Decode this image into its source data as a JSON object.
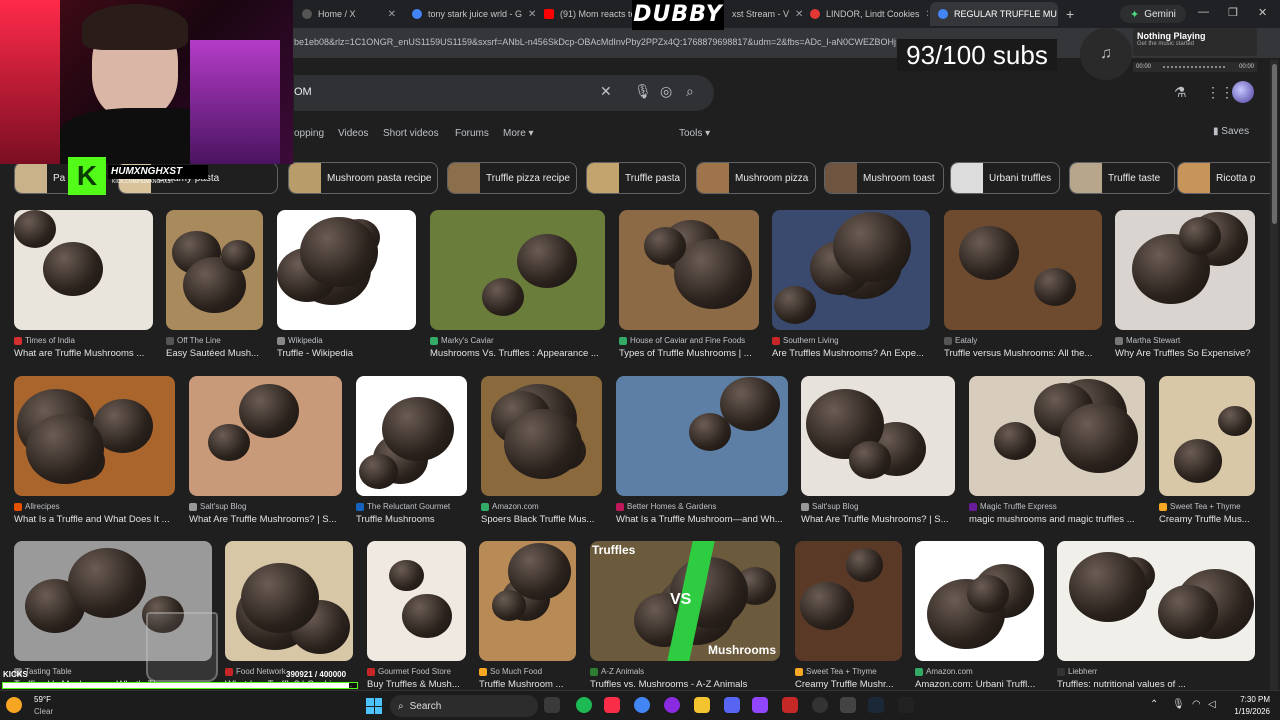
{
  "browser": {
    "tabs": [
      {
        "title": "Home / X",
        "favicon_color": "#1d1d1d",
        "active": false
      },
      {
        "title": "tony stark juice wrld - G",
        "favicon_color": "#4285f4",
        "active": false
      },
      {
        "title": "(91) Mom reacts to U",
        "favicon_color": "#ff0000",
        "active": false
      },
      {
        "title": "xst Stream - V",
        "favicon_color": "#9146ff",
        "active": false
      },
      {
        "title": "LINDOR, Lindt Cookies",
        "favicon_color": "#e53935",
        "active": false
      },
      {
        "title": "REGULAR TRUFFLE MU",
        "favicon_color": "#4285f4",
        "active": true
      }
    ],
    "new_tab_label": "+",
    "gemini_label": "Gemini",
    "url": "be1eb08&rlz=1C1ONGR_enUS1159US1159&sxsrf=ANbL-n456SkDcp-OBAcMdInvPby2PPZx4Q:1768879698817&udm=2&fbs=ADc_l-aN0CWEZBOHj"
  },
  "google": {
    "query_suffix": "OM",
    "nav_tabs": [
      "opping",
      "Videos",
      "Short videos",
      "Forums",
      "More ▾"
    ],
    "tools_label": "Tools ▾",
    "saves_label": "Saves",
    "chips": [
      {
        "label": "Pa",
        "color": "#c9b28a"
      },
      {
        "label": "Creamy pasta",
        "color": "#d8c39a"
      },
      {
        "label": "Mushroom pasta recipe",
        "color": "#b89c6a"
      },
      {
        "label": "Truffle pizza recipe",
        "color": "#8b6f4a"
      },
      {
        "label": "Truffle pasta",
        "color": "#c4a46e"
      },
      {
        "label": "Mushroom pizza",
        "color": "#a0744a"
      },
      {
        "label": "Mushroom toast",
        "color": "#6f5440"
      },
      {
        "label": "Urbani truffles",
        "color": "#dcdcdc"
      },
      {
        "label": "Truffle taste",
        "color": "#b8a68c"
      },
      {
        "label": "Ricotta p",
        "color": "#c7955a"
      }
    ],
    "results": [
      {
        "source": "Times of India",
        "caption": "What are Truffle Mushrooms ...",
        "bg": "#e9e4dc",
        "sico": "#d32f2f"
      },
      {
        "source": "Off The Line",
        "caption": "Easy Sautéed Mush...",
        "bg": "#a88a5c",
        "sico": "#555"
      },
      {
        "source": "Wikipedia",
        "caption": "Truffle - Wikipedia",
        "bg": "#ffffff",
        "sico": "#888"
      },
      {
        "source": "Marky's Caviar",
        "caption": "Mushrooms Vs. Truffles : Appearance ...",
        "bg": "#6a7d3a",
        "sico": "#3a6"
      },
      {
        "source": "House of Caviar and Fine Foods",
        "caption": "Types of Truffle Mushrooms | ...",
        "bg": "#8b6a45",
        "sico": "#3a6"
      },
      {
        "source": "Southern Living",
        "caption": "Are Truffles Mushrooms? An Expe...",
        "bg": "#3a4a6e",
        "sico": "#c62828"
      },
      {
        "source": "Eataly",
        "caption": "Truffle versus Mushrooms: All the...",
        "bg": "#6e4b2e",
        "sico": "#555"
      },
      {
        "source": "Martha Stewart",
        "caption": "Why Are Truffles So Expensive?",
        "bg": "#d9d4cf",
        "sico": "#777"
      },
      {
        "source": "Allrecipes",
        "caption": "What Is a Truffle and What Does It ...",
        "bg": "#a9652c",
        "sico": "#e65100"
      },
      {
        "source": "Salt'sup Blog",
        "caption": "What Are Truffle Mushrooms? | S...",
        "bg": "#c99a7a",
        "sico": "#999"
      },
      {
        "source": "The Reluctant Gourmet",
        "caption": "Truffle Mushrooms",
        "bg": "#ffffff",
        "sico": "#1565c0"
      },
      {
        "source": "Amazon.com",
        "caption": "Spoers Black Truffle Mus...",
        "bg": "#8a6a3c",
        "sico": "#3a6"
      },
      {
        "source": "Better Homes & Gardens",
        "caption": "What Is a Truffle Mushroom—and Wh...",
        "bg": "#5d7fa6",
        "sico": "#c2185b"
      },
      {
        "source": "Salt'sup Blog",
        "caption": "What Are Truffle Mushrooms? | S...",
        "bg": "#e7e2db",
        "sico": "#999"
      },
      {
        "source": "Magic Truffle Express",
        "caption": "magic mushrooms and magic truffles ...",
        "bg": "#d8cdbd",
        "sico": "#6a1b9a"
      },
      {
        "source": "Sweet Tea + Thyme",
        "caption": "Creamy Truffle Mus...",
        "bg": "#d8c8a8",
        "sico": "#f9a825"
      },
      {
        "source": "Tasting Table",
        "caption": "Truffles Vs Mushrooms: What's The ...",
        "bg": "#9a9a9a",
        "sico": "#777"
      },
      {
        "source": "Food Network",
        "caption": "What Is a Truffle? | Cooking ...",
        "bg": "#d7c7a6",
        "sico": "#c62828"
      },
      {
        "source": "Gourmet Food Store",
        "caption": "Buy Truffles & Mush...",
        "bg": "#efe9e1",
        "sico": "#c62828"
      },
      {
        "source": "So Much Food",
        "caption": "Truffle Mushroom ...",
        "bg": "#b88a55",
        "sico": "#f9a825"
      },
      {
        "source": "A-Z Animals",
        "caption": "Truffles vs. Mushrooms - A-Z Animals",
        "bg": "#6b5a3b",
        "sico": "#2e7d32"
      },
      {
        "source": "Sweet Tea + Thyme",
        "caption": "Creamy Truffle Mushr...",
        "bg": "#5a3a26",
        "sico": "#f9a825"
      },
      {
        "source": "Amazon.com",
        "caption": "Amazon.com: Urbani Truffl...",
        "bg": "#ffffff",
        "sico": "#3a6"
      },
      {
        "source": "Liebherr",
        "caption": "Truffles: nutritional values of ...",
        "bg": "#f1efe9",
        "sico": "#333"
      }
    ],
    "overlay_texts": {
      "vs": "VS",
      "truffles": "Truffles",
      "mushrooms": "Mushrooms"
    }
  },
  "stream": {
    "brand": "DUBBY",
    "subs": "93/100 subs",
    "kick_name": "HUMXNGHXST",
    "kick_url": "KICK.COM/HUMXNGHXST",
    "music_title": "Nothing Playing",
    "music_sub": "Get the music started",
    "time_start": "00:00",
    "time_end": "00:00",
    "kicks_label": "KICKS",
    "kicks_count": "390921  / 400000",
    "kicks_progress": 0.977
  },
  "taskbar": {
    "temp": "59°F",
    "condition": "Clear",
    "search_label": "Search",
    "time": "7:30 PM",
    "date": "1/19/2026"
  }
}
